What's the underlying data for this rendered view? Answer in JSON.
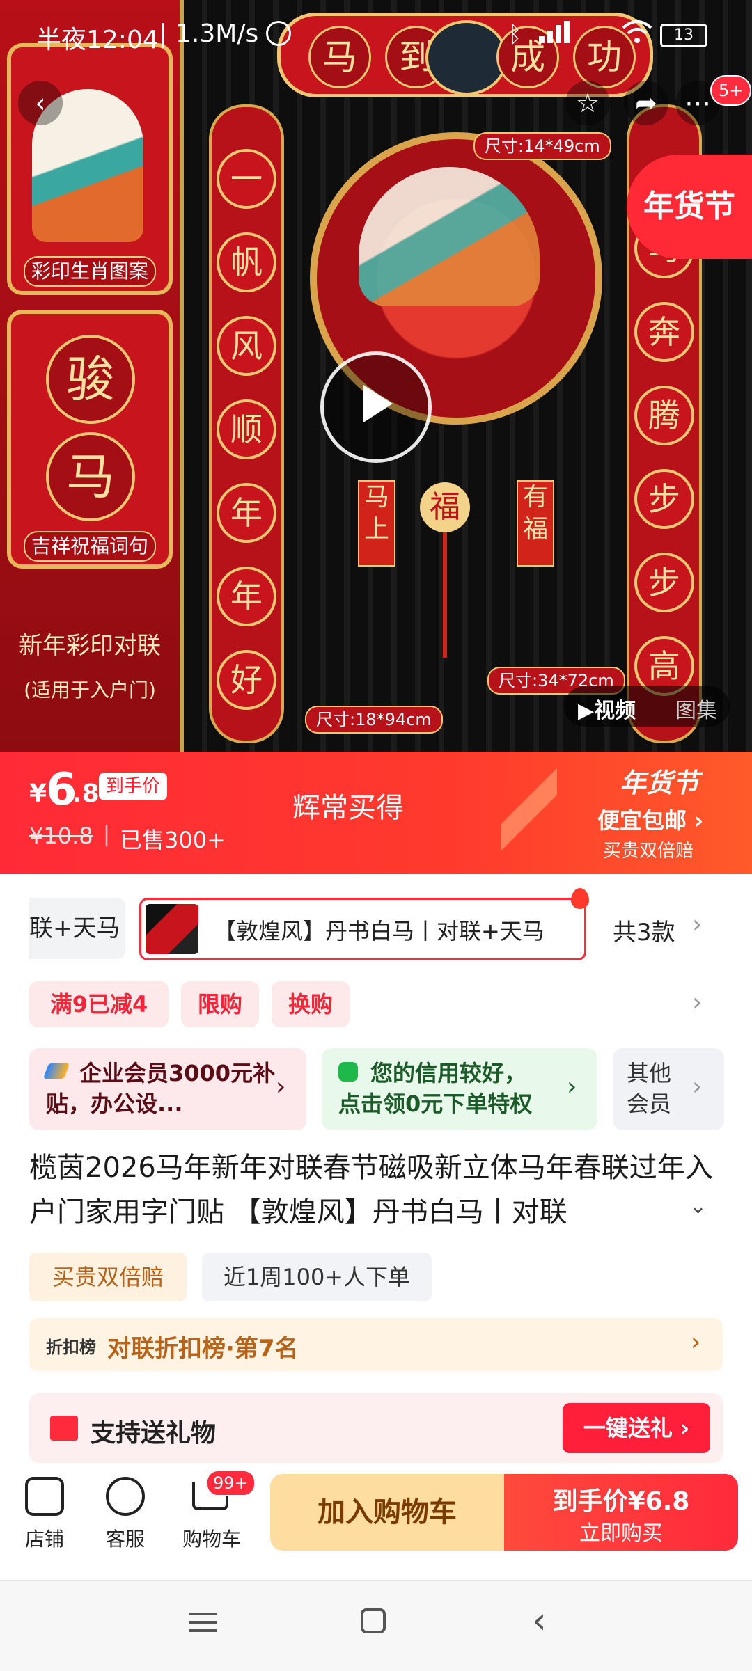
{
  "status_bar": {
    "time": "半夜12:04",
    "speed": "1.3M/s",
    "battery": "13"
  },
  "hero": {
    "left_panel": {
      "card1_label": "彩印生肖图案",
      "card2_chars": [
        "骏",
        "马"
      ],
      "card2_label": "吉祥祝福词句",
      "caption_title": "新年彩印对联",
      "caption_sub": "(适用于入户门)"
    },
    "banner_chars": [
      "马",
      "到",
      "成",
      "功"
    ],
    "left_couplet": [
      "一",
      "帆",
      "风",
      "顺",
      "年",
      "年",
      "好"
    ],
    "right_couplet": [
      "马",
      "奔",
      "腾",
      "步",
      "步",
      "高"
    ],
    "pendant_left": "马上",
    "pendant_right": "有福",
    "center_char": "福",
    "size_tags": {
      "top": "尺寸:14*49cm",
      "middle": "尺寸:34*72cm",
      "bottom": "尺寸:18*94cm"
    },
    "festival_badge": "年货节",
    "top_actions_badge": "5+",
    "media_tabs": [
      "▶视频",
      "图集"
    ]
  },
  "price_banner": {
    "currency": "¥",
    "price_int": "6",
    "price_dec": ".8",
    "price_tag": "到手价",
    "original_price": "¥10.8",
    "sold": "已售300+",
    "slogan": "辉常买得",
    "fest_title": "年货节",
    "fest_line1": "便宜包邮 ›",
    "fest_line2": "买贵双倍赔"
  },
  "sku": {
    "prev_item": "联+天马",
    "selected_item": "【敦煌风】丹书白马丨对联+天马",
    "count": "共3款"
  },
  "promos": [
    "满9已减4",
    "限购",
    "换购"
  ],
  "benefits": {
    "enterprise": "企业会员3000元补贴，办公设...",
    "credit_line1": "您的信用较好，",
    "credit_line2": "点击领0元下单特权",
    "other_line1": "其他",
    "other_line2": "会员"
  },
  "product_title": "榄茵2026马年新年对联春节磁吸新立体马年春联过年入户门家用字门贴 【敦煌风】丹书白马丨对联",
  "tags": [
    "买贵双倍赔",
    "近1周100+人下单"
  ],
  "rank": {
    "label": "折扣榜",
    "text": "对联折扣榜·第7名"
  },
  "gift": {
    "text": "支持送礼物",
    "button": "一键送礼 ›"
  },
  "bottom_bar": {
    "shop": "店铺",
    "service": "客服",
    "cart": "购物车",
    "cart_badge": "99+",
    "add_cart": "加入购物车",
    "buy_line1": "到手价¥6.8",
    "buy_line2": "立即购买"
  },
  "colors": {
    "accent_red": "#ff2a36",
    "gold": "#f0c873",
    "cart_button": "#ffdca0"
  }
}
